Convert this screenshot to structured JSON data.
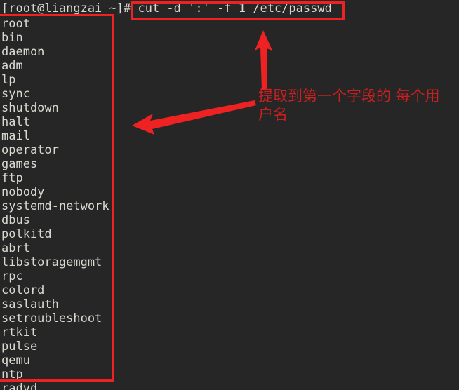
{
  "terminal": {
    "background_color": "#262626",
    "text_color": "#d9d9d1",
    "prompt": "[root@liangzai ~]#",
    "command": "cut -d ':' -f 1 /etc/passwd",
    "prompt_full_line": "[root@liangzai ~]# cut -d ':' -f 1 /etc/passwd",
    "output_lines": [
      "root",
      "bin",
      "daemon",
      "adm",
      "lp",
      "sync",
      "shutdown",
      "halt",
      "mail",
      "operator",
      "games",
      "ftp",
      "nobody",
      "systemd-network",
      "dbus",
      "polkitd",
      "abrt",
      "libstoragemgmt",
      "rpc",
      "colord",
      "saslauth",
      "setroubleshoot",
      "rtkit",
      "pulse",
      "qemu",
      "ntp",
      "radvd"
    ]
  },
  "annotations": {
    "box_color": "#ee2222",
    "text_color": "#cc1f1f",
    "note": "提取到第一个字段的 每个用户名",
    "command_box_label": "cut command highlight",
    "output_box_label": "extracted usernames highlight",
    "arrow_up_label": "arrow pointing to command",
    "arrow_left_label": "arrow pointing to username list"
  }
}
